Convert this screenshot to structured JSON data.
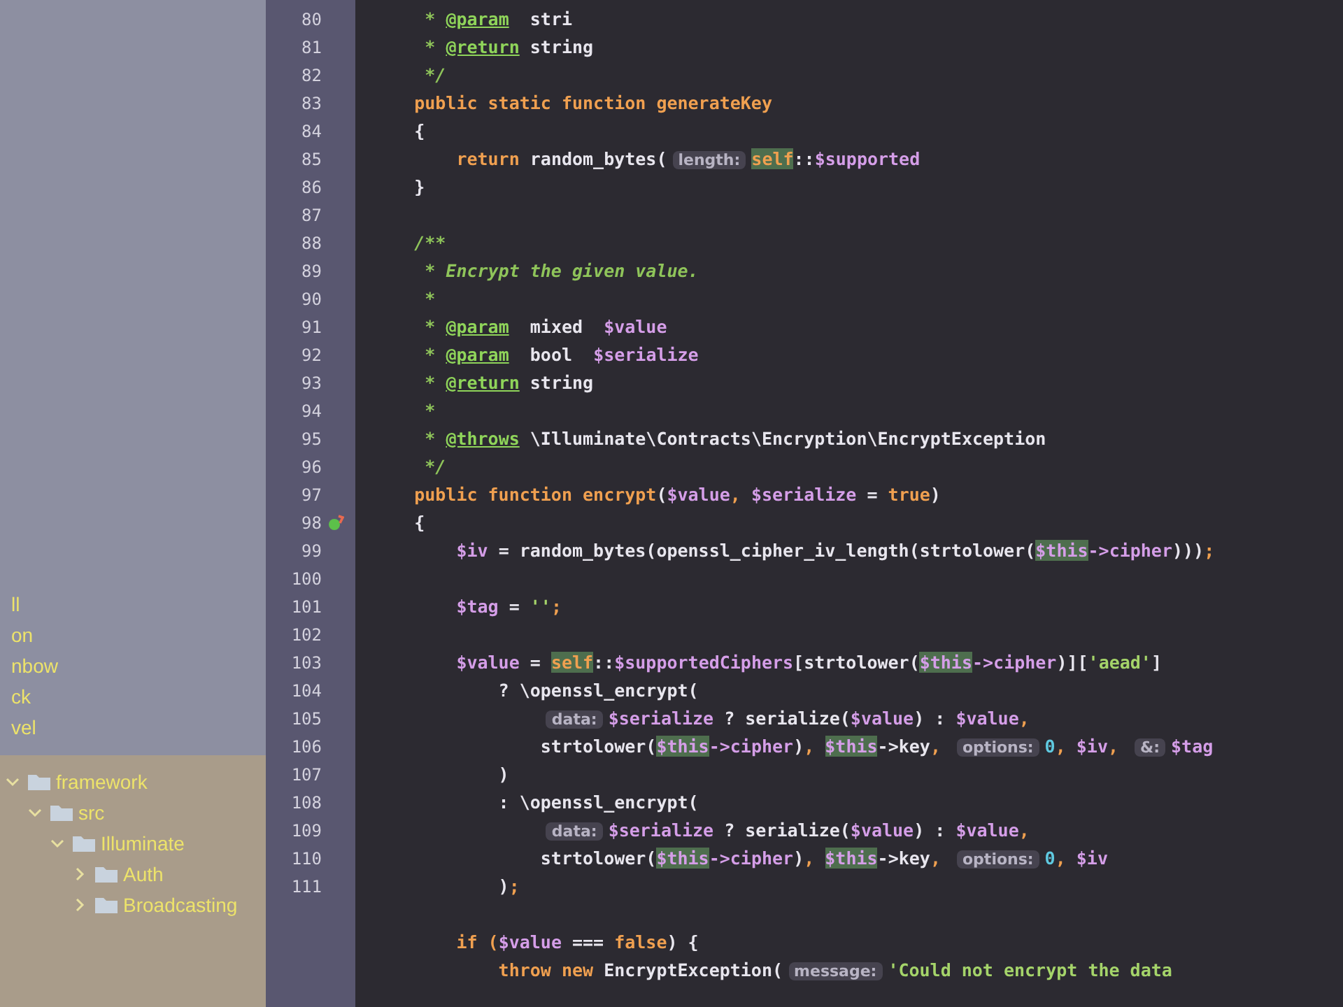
{
  "project_tree": {
    "upper_items": [
      {
        "label": "ll"
      },
      {
        "label": "on"
      },
      {
        "label": "nbow"
      },
      {
        "label": "ck"
      },
      {
        "label": "vel"
      }
    ],
    "folders": [
      {
        "label": "framework",
        "expanded": true,
        "children": [
          {
            "label": "src",
            "expanded": true,
            "children": [
              {
                "label": "Illuminate",
                "expanded": true,
                "children": [
                  {
                    "label": "Auth",
                    "expanded": false
                  },
                  {
                    "label": "Broadcasting",
                    "expanded": false
                  }
                ]
              }
            ]
          }
        ]
      }
    ]
  },
  "editor": {
    "lines": [
      {
        "number": "80",
        "breakpoint": false,
        "tokens": [
          {
            "text": "     * ",
            "kind": "doc"
          },
          {
            "text": "@param",
            "kind": "tag"
          },
          {
            "text": "  stri",
            "kind": "plain"
          }
        ]
      },
      {
        "number": "81",
        "breakpoint": false,
        "tokens": [
          {
            "text": "     * ",
            "kind": "doc"
          },
          {
            "text": "@return",
            "kind": "tag"
          },
          {
            "text": " string",
            "kind": "plain"
          }
        ]
      },
      {
        "number": "82",
        "breakpoint": false,
        "tokens": [
          {
            "text": "     */",
            "kind": "doc"
          }
        ]
      },
      {
        "number": "83",
        "breakpoint": false,
        "tokens": [
          {
            "text": "    public static function generateKey",
            "kind": "kw"
          }
        ]
      },
      {
        "number": "84",
        "breakpoint": false,
        "tokens": [
          {
            "text": "    {",
            "kind": "plain"
          }
        ]
      },
      {
        "number": "85",
        "breakpoint": false,
        "tokens": [
          {
            "text": "        return ",
            "kind": "kw"
          },
          {
            "text": "random_bytes(",
            "kind": "plain"
          },
          {
            "text": "length:",
            "kind": "hint"
          },
          {
            "text": "self",
            "kind": "hlk"
          },
          {
            "text": "::",
            "kind": "plain"
          },
          {
            "text": "$supported",
            "kind": "var"
          }
        ]
      },
      {
        "number": "86",
        "breakpoint": false,
        "tokens": [
          {
            "text": "    }",
            "kind": "plain"
          }
        ]
      },
      {
        "number": "87",
        "breakpoint": false
      },
      {
        "number": "88",
        "breakpoint": false,
        "tokens": [
          {
            "text": "    /**",
            "kind": "doc"
          }
        ]
      },
      {
        "number": "89",
        "breakpoint": false,
        "tokens": [
          {
            "text": "     * Encrypt the given value.",
            "kind": "doc"
          }
        ]
      },
      {
        "number": "90",
        "breakpoint": false,
        "tokens": [
          {
            "text": "     *",
            "kind": "doc"
          }
        ]
      },
      {
        "number": "91",
        "breakpoint": false,
        "tokens": [
          {
            "text": "     * ",
            "kind": "doc"
          },
          {
            "text": "@param",
            "kind": "tag"
          },
          {
            "text": "  mixed  ",
            "kind": "plain"
          },
          {
            "text": "$value",
            "kind": "var"
          }
        ]
      },
      {
        "number": "92",
        "breakpoint": false,
        "tokens": [
          {
            "text": "     * ",
            "kind": "doc"
          },
          {
            "text": "@param",
            "kind": "tag"
          },
          {
            "text": "  bool  ",
            "kind": "plain"
          },
          {
            "text": "$serialize",
            "kind": "var"
          }
        ]
      },
      {
        "number": "93",
        "breakpoint": false,
        "tokens": [
          {
            "text": "     * ",
            "kind": "doc"
          },
          {
            "text": "@return",
            "kind": "tag"
          },
          {
            "text": " string",
            "kind": "plain"
          }
        ]
      },
      {
        "number": "94",
        "breakpoint": false,
        "tokens": [
          {
            "text": "     *",
            "kind": "doc"
          }
        ]
      },
      {
        "number": "95",
        "breakpoint": false,
        "tokens": [
          {
            "text": "     * ",
            "kind": "doc"
          },
          {
            "text": "@throws",
            "kind": "tag"
          },
          {
            "text": " \\Illuminate\\Contracts\\Encryption\\EncryptException",
            "kind": "plain"
          }
        ]
      },
      {
        "number": "96",
        "breakpoint": false,
        "tokens": [
          {
            "text": "     */",
            "kind": "doc"
          }
        ]
      },
      {
        "number": "97",
        "breakpoint": false,
        "tokens": [
          {
            "text": "    public function encrypt",
            "kind": "kw"
          },
          {
            "text": "(",
            "kind": "plain"
          },
          {
            "text": "$value",
            "kind": "var"
          },
          {
            "text": ", ",
            "kind": "punc"
          },
          {
            "text": "$serialize",
            "kind": "var"
          },
          {
            "text": " = ",
            "kind": "plain"
          },
          {
            "text": "true",
            "kind": "kw"
          },
          {
            "text": ")",
            "kind": "plain"
          }
        ]
      },
      {
        "number": "98",
        "breakpoint": true,
        "tokens": [
          {
            "text": "    {",
            "kind": "plain"
          }
        ]
      },
      {
        "number": "99",
        "breakpoint": false,
        "tokens": [
          {
            "text": "        $iv",
            "kind": "var"
          },
          {
            "text": " = random_bytes(openssl_cipher_iv_length(strtolower(",
            "kind": "plain"
          },
          {
            "text": "$this",
            "kind": "hl"
          },
          {
            "text": "->cipher",
            "kind": "var"
          },
          {
            "text": ")))",
            "kind": "plain"
          },
          {
            "text": ";",
            "kind": "punc"
          }
        ]
      },
      {
        "number": "100",
        "breakpoint": false
      },
      {
        "number": "101",
        "breakpoint": false,
        "tokens": [
          {
            "text": "        $tag",
            "kind": "var"
          },
          {
            "text": " = ",
            "kind": "plain"
          },
          {
            "text": "''",
            "kind": "str"
          },
          {
            "text": ";",
            "kind": "punc"
          }
        ]
      },
      {
        "number": "102",
        "breakpoint": false
      },
      {
        "number": "103",
        "breakpoint": false,
        "tokens": [
          {
            "text": "        $value",
            "kind": "var"
          },
          {
            "text": " = ",
            "kind": "plain"
          },
          {
            "text": "self",
            "kind": "hlk"
          },
          {
            "text": "::",
            "kind": "plain"
          },
          {
            "text": "$supportedCiphers",
            "kind": "var"
          },
          {
            "text": "[strtolower(",
            "kind": "plain"
          },
          {
            "text": "$this",
            "kind": "hl"
          },
          {
            "text": "->cipher",
            "kind": "var"
          },
          {
            "text": ")][",
            "kind": "plain"
          },
          {
            "text": "'aead'",
            "kind": "str"
          },
          {
            "text": "]",
            "kind": "plain"
          }
        ]
      },
      {
        "number": "104",
        "breakpoint": false,
        "tokens": [
          {
            "text": "            ? \\openssl_encrypt(",
            "kind": "plain"
          }
        ]
      },
      {
        "number": "105",
        "breakpoint": false,
        "tokens": [
          {
            "text": "                data:",
            "kind": "hint"
          },
          {
            "text": "$serialize",
            "kind": "var"
          },
          {
            "text": " ? serialize(",
            "kind": "plain"
          },
          {
            "text": "$value",
            "kind": "var"
          },
          {
            "text": ") : ",
            "kind": "plain"
          },
          {
            "text": "$value",
            "kind": "var"
          },
          {
            "text": ",",
            "kind": "punc"
          }
        ]
      },
      {
        "number": "106",
        "breakpoint": false,
        "tokens": [
          {
            "text": "                strtolower(",
            "kind": "plain"
          },
          {
            "text": "$this",
            "kind": "hl"
          },
          {
            "text": "->cipher",
            "kind": "var"
          },
          {
            "text": ")",
            "kind": "plain"
          },
          {
            "text": ", ",
            "kind": "punc"
          },
          {
            "text": "$this",
            "kind": "hl"
          },
          {
            "text": "->key",
            "kind": "plain"
          },
          {
            "text": ", ",
            "kind": "punc"
          },
          {
            "text": "options:",
            "kind": "hint"
          },
          {
            "text": "0",
            "kind": "num"
          },
          {
            "text": ", ",
            "kind": "punc"
          },
          {
            "text": "$iv",
            "kind": "var"
          },
          {
            "text": ", ",
            "kind": "punc"
          },
          {
            "text": "&:",
            "kind": "hint"
          },
          {
            "text": "$tag",
            "kind": "var"
          }
        ]
      },
      {
        "number": "107",
        "breakpoint": false,
        "tokens": [
          {
            "text": "            )",
            "kind": "plain"
          }
        ]
      },
      {
        "number": "108",
        "breakpoint": false,
        "tokens": [
          {
            "text": "            : \\openssl_encrypt(",
            "kind": "plain"
          }
        ]
      },
      {
        "number": "109",
        "breakpoint": false,
        "tokens": [
          {
            "text": "                data:",
            "kind": "hint"
          },
          {
            "text": "$serialize",
            "kind": "var"
          },
          {
            "text": " ? serialize(",
            "kind": "plain"
          },
          {
            "text": "$value",
            "kind": "var"
          },
          {
            "text": ") : ",
            "kind": "plain"
          },
          {
            "text": "$value",
            "kind": "var"
          },
          {
            "text": ",",
            "kind": "punc"
          }
        ]
      },
      {
        "number": "110",
        "breakpoint": false,
        "tokens": [
          {
            "text": "                strtolower(",
            "kind": "plain"
          },
          {
            "text": "$this",
            "kind": "hl"
          },
          {
            "text": "->cipher",
            "kind": "var"
          },
          {
            "text": ")",
            "kind": "plain"
          },
          {
            "text": ", ",
            "kind": "punc"
          },
          {
            "text": "$this",
            "kind": "hl"
          },
          {
            "text": "->key",
            "kind": "plain"
          },
          {
            "text": ", ",
            "kind": "punc"
          },
          {
            "text": "options:",
            "kind": "hint"
          },
          {
            "text": "0",
            "kind": "num"
          },
          {
            "text": ", ",
            "kind": "punc"
          },
          {
            "text": "$iv",
            "kind": "var"
          }
        ]
      },
      {
        "number": "111",
        "breakpoint": false,
        "tokens": [
          {
            "text": "            )",
            "kind": "plain"
          },
          {
            "text": ";",
            "kind": "punc"
          }
        ]
      },
      {
        "breakpoint": false
      },
      {
        "breakpoint": false,
        "tokens": [
          {
            "text": "        if (",
            "kind": "kw"
          },
          {
            "text": "$value",
            "kind": "var"
          },
          {
            "text": " === ",
            "kind": "plain"
          },
          {
            "text": "false",
            "kind": "kw"
          },
          {
            "text": ") {",
            "kind": "plain"
          }
        ]
      },
      {
        "breakpoint": false,
        "tokens": [
          {
            "text": "            throw new ",
            "kind": "kw"
          },
          {
            "text": "EncryptException(",
            "kind": "plain"
          },
          {
            "text": "message:",
            "kind": "hint"
          },
          {
            "text": "'Could not encrypt the data",
            "kind": "str"
          }
        ]
      }
    ]
  }
}
